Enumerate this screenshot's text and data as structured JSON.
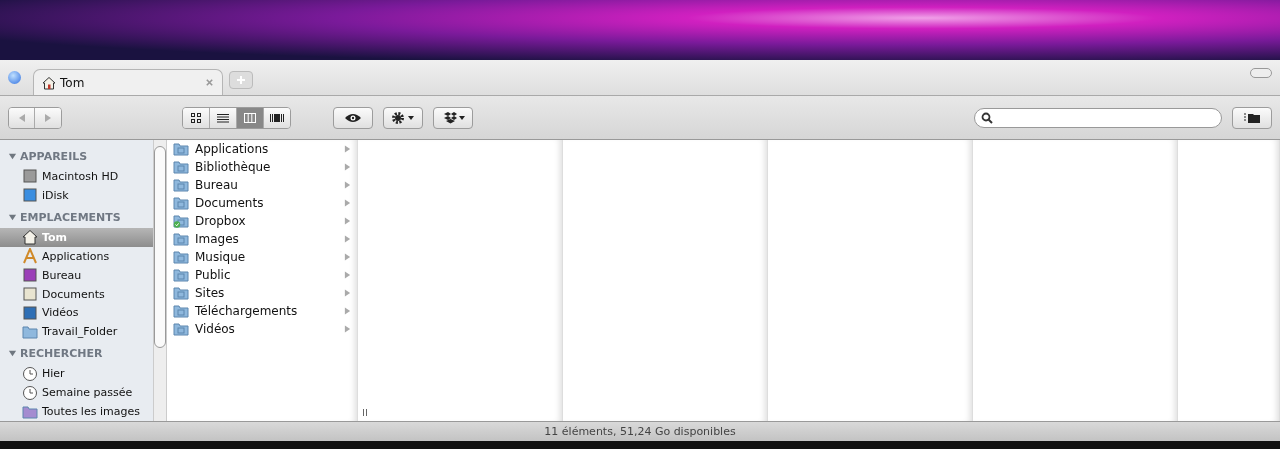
{
  "tabs": [
    {
      "label": "Tom",
      "selected": true
    }
  ],
  "view_modes": [
    {
      "kind": "icons",
      "selected": false
    },
    {
      "kind": "list",
      "selected": false
    },
    {
      "kind": "columns",
      "selected": true
    },
    {
      "kind": "coverflow",
      "selected": false
    }
  ],
  "sidebar": [
    {
      "title": "APPAREILS",
      "expanded": true,
      "items": [
        {
          "label": "Macintosh HD",
          "kind": "disk",
          "selected": false
        },
        {
          "label": "iDisk",
          "kind": "idisk",
          "selected": false
        }
      ]
    },
    {
      "title": "EMPLACEMENTS",
      "expanded": true,
      "items": [
        {
          "label": "Tom",
          "kind": "home",
          "selected": true
        },
        {
          "label": "Applications",
          "kind": "apps",
          "selected": false
        },
        {
          "label": "Bureau",
          "kind": "desktop",
          "selected": false
        },
        {
          "label": "Documents",
          "kind": "doc",
          "selected": false
        },
        {
          "label": "Vidéos",
          "kind": "video",
          "selected": false
        },
        {
          "label": "Travail_Folder",
          "kind": "folder",
          "selected": false
        }
      ]
    },
    {
      "title": "RECHERCHER",
      "expanded": true,
      "items": [
        {
          "label": "Hier",
          "kind": "clock",
          "selected": false
        },
        {
          "label": "Semaine passée",
          "kind": "clock",
          "selected": false
        },
        {
          "label": "Toutes les images",
          "kind": "smart",
          "selected": false
        }
      ]
    }
  ],
  "column_items": [
    {
      "label": "Applications",
      "synced": false
    },
    {
      "label": "Bibliothèque",
      "synced": false
    },
    {
      "label": "Bureau",
      "synced": false
    },
    {
      "label": "Documents",
      "synced": false
    },
    {
      "label": "Dropbox",
      "synced": true
    },
    {
      "label": "Images",
      "synced": false
    },
    {
      "label": "Musique",
      "synced": false
    },
    {
      "label": "Public",
      "synced": false
    },
    {
      "label": "Sites",
      "synced": false
    },
    {
      "label": "Téléchargements",
      "synced": false
    },
    {
      "label": "Vidéos",
      "synced": false
    }
  ],
  "status_bar": "11 éléments, 51,24 Go disponibles"
}
